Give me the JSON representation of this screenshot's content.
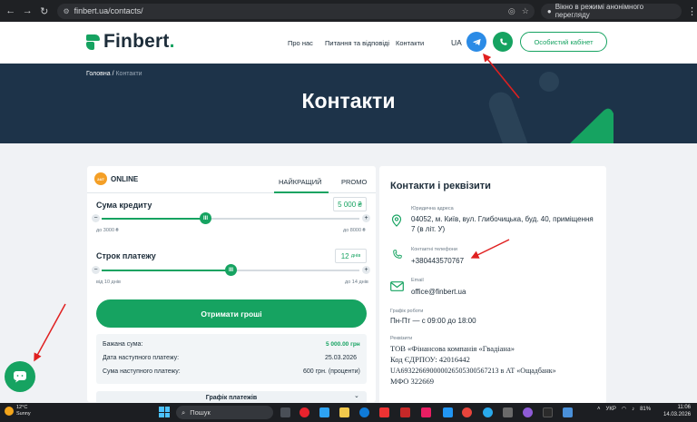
{
  "browser": {
    "url": "finbert.ua/contacts/",
    "incognito_label": "Вікно в режимі анонімного перегляду"
  },
  "header": {
    "logo_text": "Finbert",
    "menu": [
      "Про нас",
      "Питання та відповіді",
      "Контакти"
    ],
    "lang": "UA",
    "cabinet_label": "Особистий кабінет"
  },
  "hero": {
    "breadcrumb_home": "Головна",
    "breadcrumb_sep": "/",
    "breadcrumb_current": "Контакти",
    "title": "Контакти"
  },
  "calculator": {
    "badge": "24/7",
    "online_label": "ONLINE",
    "tab_best": "НАЙКРАЩИЙ",
    "tab_promo": "PROMO",
    "amount_label": "Сума кредиту",
    "amount_value": "5 000 ₴",
    "amount_min": "до 3000 ₴",
    "amount_max": "до 8000 ₴",
    "amount_fraction": 0.4,
    "term_label": "Строк платежу",
    "term_value": "12",
    "term_unit": "днів",
    "term_min": "від 10 днів",
    "term_max": "до 14 днів",
    "term_fraction": 0.5,
    "get_money": "Отримати гроші",
    "summary": [
      {
        "label": "Бажана сума:",
        "value": "5 000.00 грн"
      },
      {
        "label": "Дата наступного платежу:",
        "value": "25.03.2026"
      },
      {
        "label": "Сума наступного платежу:",
        "value": "600 грн. (проценти)"
      }
    ],
    "schedule_label": "Графік платежів"
  },
  "contacts": {
    "title": "Контакти і реквізити",
    "address_label": "Юридична адреса",
    "address": "04052, м. Київ, вул. Глибочицька, буд. 40, приміщення 7 (в літ. У)",
    "phone_label": "Контактні телефони",
    "phone": "+380443570767",
    "email_label": "Email",
    "email": "office@finbert.ua",
    "hours_label": "Графік роботи",
    "hours": "Пн-Пт — с 09:00 до 18:00",
    "req_label": "Реквізити",
    "req_lines": [
      "ТОВ «Фінансова компанія «Гвадіана»",
      "Код ЄДРПОУ: 42016442",
      "UA693226690000026505300567213 в АТ «Ощадбанк»",
      "МФО 322669"
    ]
  },
  "taskbar": {
    "temp": "12°C",
    "weather": "Sunny",
    "search_placeholder": "Пошук",
    "lang": "УКР",
    "battery": "81%",
    "time": "11:06",
    "date": "14.03.2026"
  },
  "colors": {
    "brand_green": "#16a361",
    "hero_navy": "#1d3349",
    "telegram_blue": "#2b8be6",
    "annotation_red": "#e02020"
  }
}
